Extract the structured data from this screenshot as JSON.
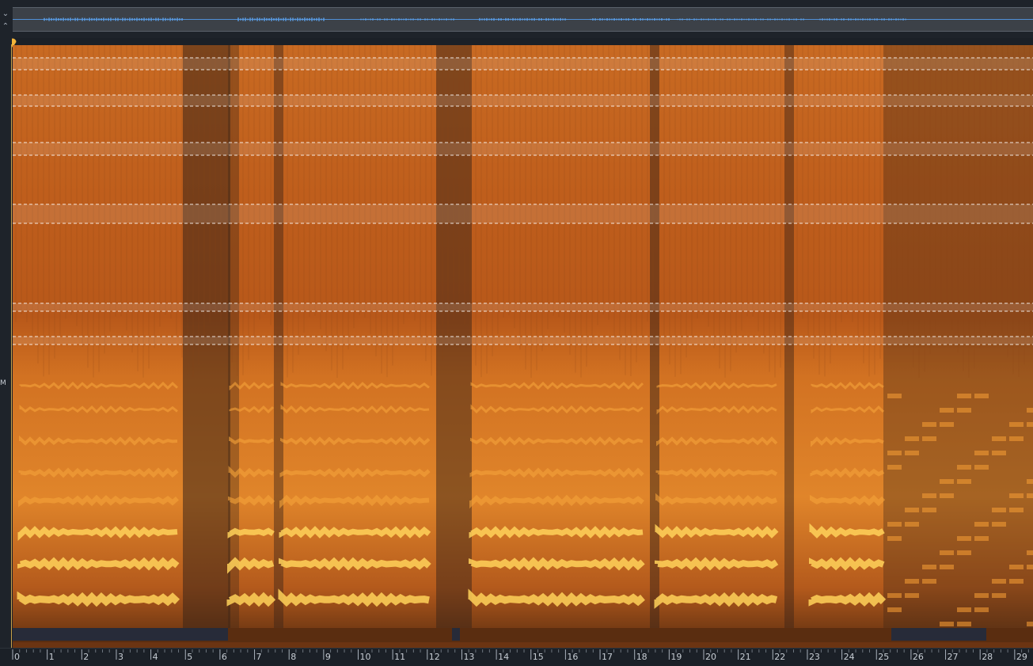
{
  "overview": {
    "collapse_up_icon": "chevron-up-icon",
    "collapse_down_icon": "chevron-down-icon",
    "waveform_color": "#4f8fd6"
  },
  "playhead": {
    "icon": "playhead-marker-icon",
    "color": "#f2b43a"
  },
  "frequency_ruler": {
    "label": "M"
  },
  "spectrogram": {
    "colormap": [
      "#1a2a44",
      "#5a2d10",
      "#b8581a",
      "#f08a24",
      "#ffd25a"
    ],
    "selection_bands": 8
  },
  "time_ruler": {
    "labels": [
      "0",
      "1",
      "2",
      "3",
      "4",
      "5",
      "6",
      "7",
      "8",
      "9",
      "10",
      "11",
      "12",
      "13",
      "14",
      "15",
      "16",
      "17",
      "18",
      "19",
      "20",
      "21",
      "22",
      "23",
      "24",
      "25",
      "26",
      "27",
      "28",
      "29"
    ]
  }
}
